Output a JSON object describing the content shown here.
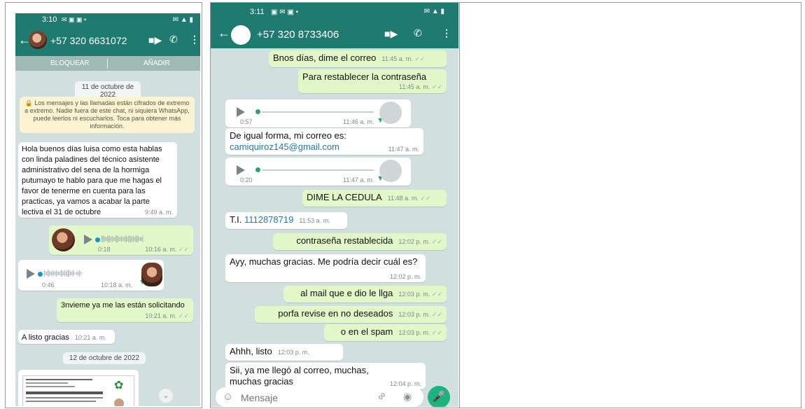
{
  "left": {
    "status": {
      "time": "3:10",
      "icons": "✉ ▣ ▣ •",
      "right_icons": "✉ ▲ ▮"
    },
    "contact": "+57 320 6631072",
    "block_label": "BLOQUEAR",
    "add_label": "AÑADIR",
    "date1": "11 de octubre de 2022",
    "encryption": "🔒 Los mensajes y las llamadas están cifrados de extremo a extremo. Nadie fuera de este chat, ni siquiera WhatsApp, puede leerlos ni escucharlos. Toca para obtener más información.",
    "messages": [
      {
        "text": "Hola buenos días luisa como esta hablas con linda paladines  del técnico asistente administrativo del sena  de la hormiga putumayo te hablo para que me hagas el favor de tenerme en cuenta para las practicas, ya vamos a acabar la parte lectiva el 31 de octubre",
        "time": "9:49 a. m."
      },
      {
        "text": "3nvieme ya me las están solicitando",
        "time": "10:21 a. m."
      },
      {
        "text": "A listo gracias",
        "time": "10:21 a. m."
      }
    ],
    "voice1": {
      "duration": "0:18",
      "time": "10:16 a. m."
    },
    "voice2": {
      "duration": "0:46",
      "time": "10:18 a. m."
    },
    "date2": "12 de octubre de 2022"
  },
  "right": {
    "status": {
      "time": "3:11",
      "icons": "▣ ✉ ▣ •",
      "right_icons": "✉ ▲ ▮"
    },
    "contact": "+57 320 8733406",
    "messages": [
      {
        "text": "Bnos días, dime el correo",
        "time": "11:45 a. m."
      },
      {
        "text": "Para restablecer la contraseña",
        "time": "11:45 a. m."
      },
      {
        "text": "De igual forma, mi correo es:",
        "link": "camiquiroz145@gmail.com",
        "time": "11:47 a. m."
      },
      {
        "text": "DIME LA CEDULA",
        "time": "11:48 a. m."
      },
      {
        "text": "T.I. ",
        "link": "1112878719",
        "time": "11:53 a. m."
      },
      {
        "text": "contraseña restablecida",
        "time": "12:02 p. m."
      },
      {
        "text": "Ayy, muchas gracias. Me podría decir cuál es?",
        "time": "12:02 p. m."
      },
      {
        "text": "al mail que e dio le llga",
        "time": "12:03 p. m."
      },
      {
        "text": "porfa revise en no deseados",
        "time": "12:03 p. m."
      },
      {
        "text": "o en el spam",
        "time": "12:03 p. m."
      },
      {
        "text": "Ahhh, listo",
        "time": "12:03 p. m."
      },
      {
        "text": "Sii, ya me llegó al correo, muchas, muchas gracias",
        "time": "12:04 p. m."
      }
    ],
    "voice1": {
      "duration": "0:57",
      "time": "11:46 a. m."
    },
    "voice2": {
      "duration": "0:20",
      "time": "11:47 a. m."
    },
    "input_placeholder": "Mensaje"
  },
  "colors": {
    "header": "#1f7a6f",
    "chat_bg": "#d1e0df",
    "outgoing": "#e3f8c9",
    "incoming": "#ffffff",
    "send": "#1db37c"
  }
}
